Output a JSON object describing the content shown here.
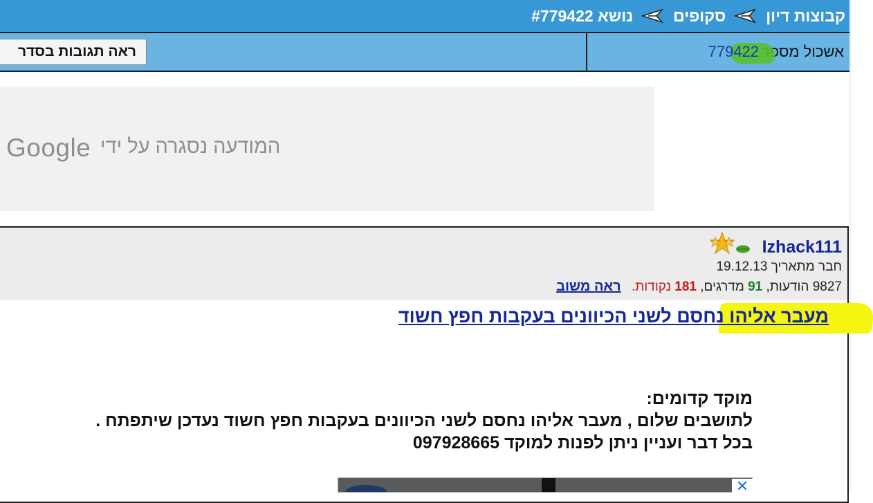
{
  "nav": {
    "groups_label": "קבוצות דיון",
    "section_label": "סקופים",
    "topic_label": "נושא #779422"
  },
  "info_row": {
    "cluster_label": "אשכול מספר",
    "cluster_number": "779422",
    "sequence_button": "ראה תגובות בסדר"
  },
  "ad": {
    "closed_text": "המודעה נסגרה על ידי",
    "google_text": "Google"
  },
  "post": {
    "username": "Izhack111",
    "member_since_label": "חבר מתאריך",
    "member_since_date": "19.12.13",
    "messages_count": "9827",
    "messages_label": "הודעות,",
    "ratings_count": "91",
    "ratings_label": "מדרגים,",
    "points_count": "181",
    "points_label": "נקודות.",
    "reply_link": "ראה משוב",
    "title": "מעבר אליהו נחסם לשני הכיוונים בעקבות חפץ חשוד",
    "body_lines": [
      "מוקד קדומים:",
      "לתושבים שלום , מעבר אליהו נחסם לשני הכיוונים בעקבות חפץ חשוד נעדכן שיתפתח .",
      "בכל דבר ועניין ניתן לפנות למוקד 097928665"
    ]
  },
  "colors": {
    "topbar": "#3898d5",
    "inforow": "#6ab4e3",
    "link_blue": "#13279a",
    "highlight_yellow": "#f5f511",
    "highlight_green": "#58c12c"
  },
  "icons": [
    "plane-icon",
    "leaf-icon",
    "stars-badge-icon",
    "close-icon"
  ]
}
